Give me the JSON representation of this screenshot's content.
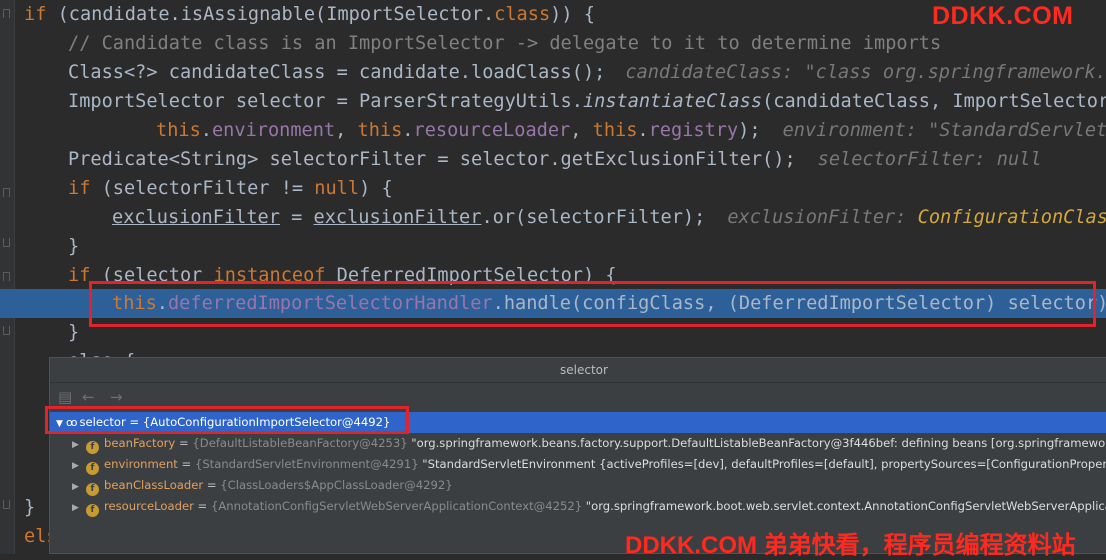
{
  "watermark": {
    "top": "DDKK.COM",
    "bottom": "DDKK.COM 弟弟快看，程序员编程资料站"
  },
  "code": {
    "line1": {
      "kw_if": "if",
      "a": " (candidate.isAssignable(ImportSelector.",
      "kw_class": "class",
      "b": ")) {"
    },
    "line2": {
      "comment": "// Candidate class is an ImportSelector -> delegate to it to determine imports"
    },
    "line3": {
      "code": "Class<?> candidateClass = candidate.loadClass();",
      "hint": "candidateClass: \"class org.springframework.bo"
    },
    "line4": {
      "a": "ImportSelector selector = ParserStrategyUtils.",
      "method": "instantiateClass",
      "b": "(candidateClass, ImportSelector.c"
    },
    "line5": {
      "kw_this1": "this",
      "fld1": "environment",
      "kw_this2": "this",
      "fld2": "resourceLoader",
      "kw_this3": "this",
      "fld3": "registry",
      "end": ");",
      "hint_label": "environment: ",
      "hint_value": "\"StandardServletEn"
    },
    "line6": {
      "a": "Predicate<String> selectorFilter = selector.getExclusionFilter();",
      "hint_label": "selectorFilter: ",
      "hint_value": "null"
    },
    "line7": {
      "kw_if": "if",
      "a": " (selectorFilter != ",
      "kw_null": "null",
      "b": ") {"
    },
    "line8": {
      "var1": "exclusionFilter",
      "eq": " = ",
      "var2": "exclusionFilter",
      "b": ".or(selectorFilter);",
      "hint_label": "exclusionFilter: ",
      "hint_value": "ConfigurationClassP"
    },
    "line9": {
      "text": "}"
    },
    "line10": {
      "kw_if": "if",
      "a": " (selector ",
      "kw_instanceof": "instanceof",
      "b": " DeferredImportSelector) {"
    },
    "line11": {
      "kw_this": "this",
      "dot": ".",
      "fld": "deferredImportSelectorHandler",
      "b": ".handle(configClass, (DeferredImportSelector) selector);"
    },
    "line12": {
      "text": "}"
    },
    "line13": {
      "text": "else {"
    },
    "line18": {
      "text": "}"
    },
    "line19": {
      "text": "else"
    }
  },
  "popup": {
    "title": "selector",
    "toolbar": {
      "collapse_icon": "tree-collapse-icon",
      "back_icon": "arrow-left-icon",
      "forward_icon": "arrow-right-icon"
    },
    "root": {
      "name": "selector",
      "eq": " = ",
      "type": "{AutoConfigurationImportSelector@4492}"
    },
    "fields": [
      {
        "name": "beanFactory",
        "type": "{DefaultListableBeanFactory@4253}",
        "value": "\"org.springframework.beans.factory.support.DefaultListableBeanFactory@3f446bef: defining beans [org.springframework"
      },
      {
        "name": "environment",
        "type": "{StandardServletEnvironment@4291}",
        "value": "\"StandardServletEnvironment {activeProfiles=[dev], defaultProfiles=[default], propertySources=[ConfigurationPropertySo"
      },
      {
        "name": "beanClassLoader",
        "type": "{ClassLoaders$AppClassLoader@4292}",
        "value": ""
      },
      {
        "name": "resourceLoader",
        "type": "{AnnotationConfigServletWebServerApplicationContext@4252}",
        "value": "\"org.springframework.boot.web.servlet.context.AnnotationConfigServletWebServerApplicat"
      }
    ]
  }
}
